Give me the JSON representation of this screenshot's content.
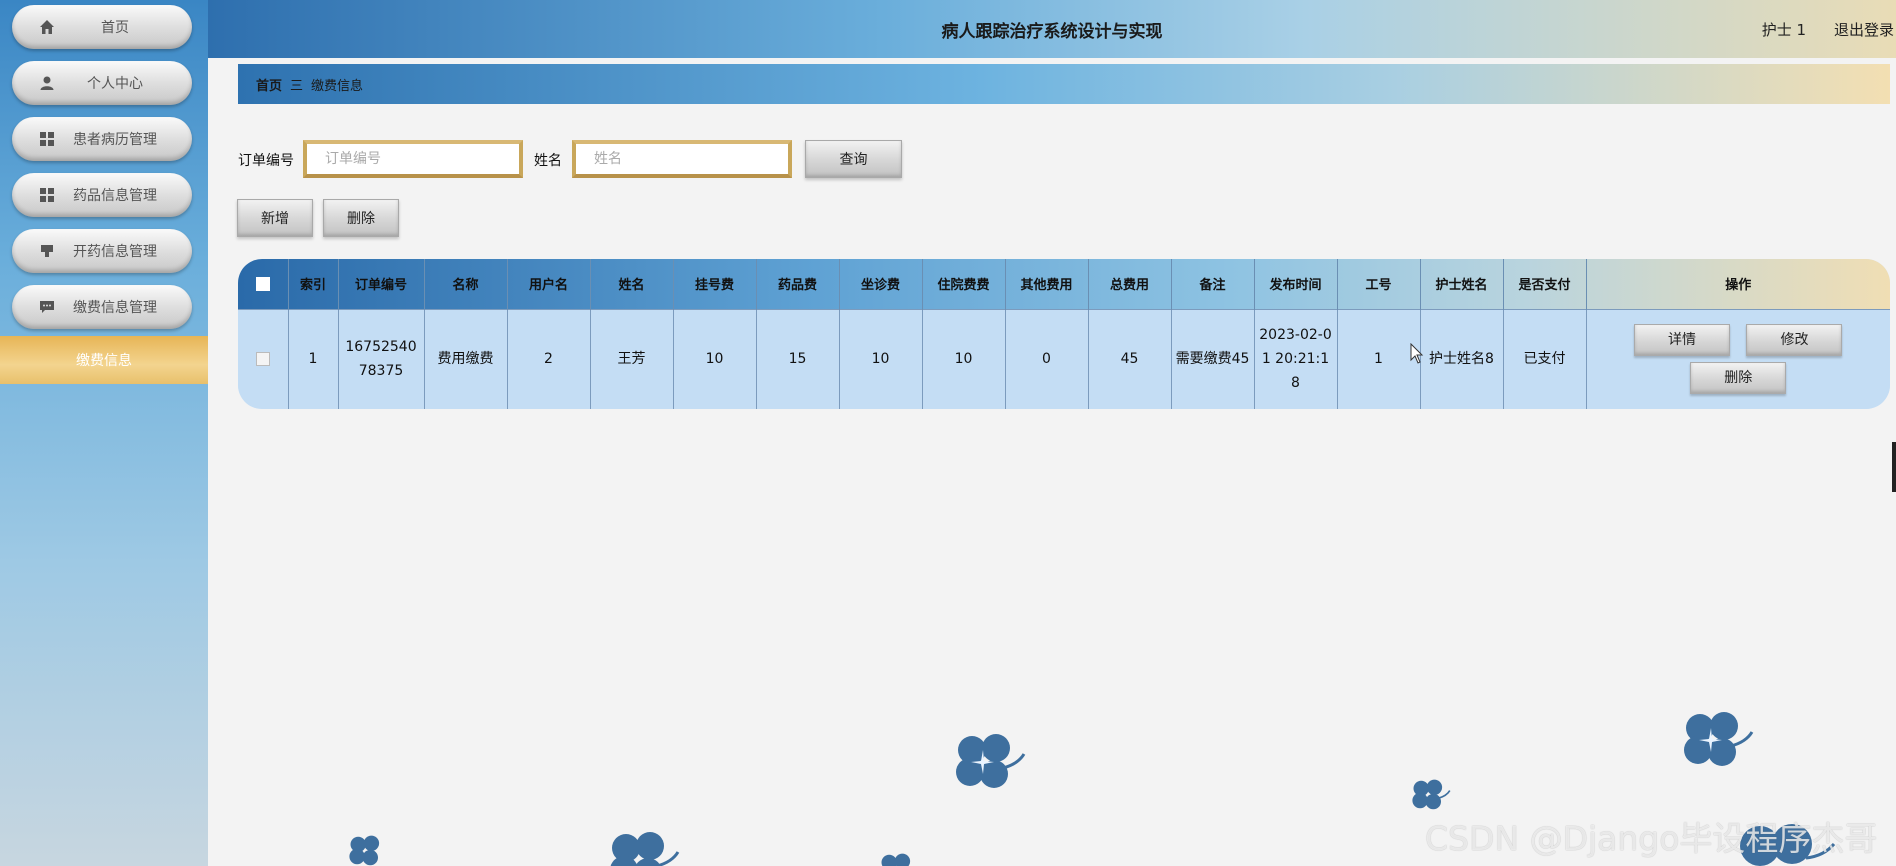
{
  "app": {
    "title": "病人跟踪治疗系统设计与实现",
    "user": "护士 1",
    "logout": "退出登录"
  },
  "sidebar": {
    "items": [
      {
        "label": "首页",
        "icon": "home-icon"
      },
      {
        "label": "个人中心",
        "icon": "user-icon"
      },
      {
        "label": "患者病历管理",
        "icon": "grid-icon"
      },
      {
        "label": "药品信息管理",
        "icon": "grid-icon"
      },
      {
        "label": "开药信息管理",
        "icon": "stamp-icon"
      },
      {
        "label": "缴费信息管理",
        "icon": "chat-icon"
      }
    ],
    "active_sub": "缴费信息"
  },
  "breadcrumb": {
    "home": "首页",
    "separator": "三",
    "current": "缴费信息"
  },
  "search": {
    "order_label": "订单编号",
    "order_placeholder": "订单编号",
    "name_label": "姓名",
    "name_placeholder": "姓名",
    "query_button": "查询"
  },
  "actions": {
    "add": "新增",
    "delete": "删除"
  },
  "table": {
    "headers": [
      "索引",
      "订单编号",
      "名称",
      "用户名",
      "姓名",
      "挂号费",
      "药品费",
      "坐诊费",
      "住院费费",
      "其他费用",
      "总费用",
      "备注",
      "发布时间",
      "工号",
      "护士姓名",
      "是否支付",
      "操作"
    ],
    "rows": [
      {
        "index": "1",
        "order_no": "1675254078375",
        "name": "费用缴费",
        "username": "2",
        "real_name": "王芳",
        "registration_fee": "10",
        "drug_fee": "15",
        "consult_fee": "10",
        "hospital_fee": "10",
        "other_fee": "0",
        "total_fee": "45",
        "remark": "需要缴费45",
        "publish_time": "2023-02-01 20:21:18",
        "staff_no": "1",
        "nurse_name": "护士姓名8",
        "paid": "已支付",
        "btn_detail": "详情",
        "btn_edit": "修改",
        "btn_delete": "删除"
      }
    ]
  },
  "watermark": "CSDN @Django毕设程序杰哥",
  "colors": {
    "accent_blue": "#2e6fae",
    "accent_gold": "#e7b556",
    "row_blue": "#c4ddf4"
  }
}
